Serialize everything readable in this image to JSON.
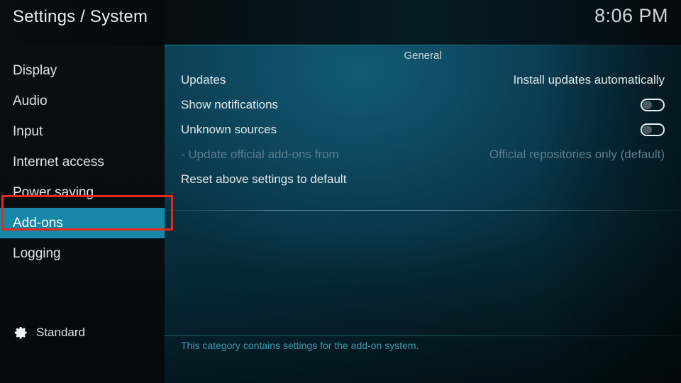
{
  "header": {
    "title": "Settings / System",
    "clock": "8:06 PM"
  },
  "sidebar": {
    "items": [
      {
        "label": "Display",
        "selected": false
      },
      {
        "label": "Audio",
        "selected": false
      },
      {
        "label": "Input",
        "selected": false
      },
      {
        "label": "Internet access",
        "selected": false
      },
      {
        "label": "Power saving",
        "selected": false
      },
      {
        "label": "Add-ons",
        "selected": true
      },
      {
        "label": "Logging",
        "selected": false
      }
    ],
    "profile": {
      "icon": "gear-icon",
      "label": "Standard"
    }
  },
  "main": {
    "group_title": "General",
    "settings": [
      {
        "label": "Updates",
        "value": "Install updates automatically",
        "control": "value",
        "disabled": false
      },
      {
        "label": "Show notifications",
        "value": "",
        "control": "toggle",
        "toggle_on": false,
        "disabled": false
      },
      {
        "label": "Unknown sources",
        "value": "",
        "control": "toggle",
        "toggle_on": false,
        "disabled": false
      },
      {
        "label": "- Update official add-ons from",
        "value": "Official repositories only (default)",
        "control": "value",
        "disabled": true
      }
    ],
    "reset_label": "Reset above settings to default",
    "description": "This category contains settings for the add-on system."
  },
  "annotation": {
    "target": "Add-ons",
    "color": "#e8281c"
  },
  "colors": {
    "highlight": "#1787a8",
    "accent_line": "#2ea0be",
    "description_text": "#3f97ad",
    "disabled_text": "#5d7f8e",
    "annotation_red": "#e8281c"
  }
}
